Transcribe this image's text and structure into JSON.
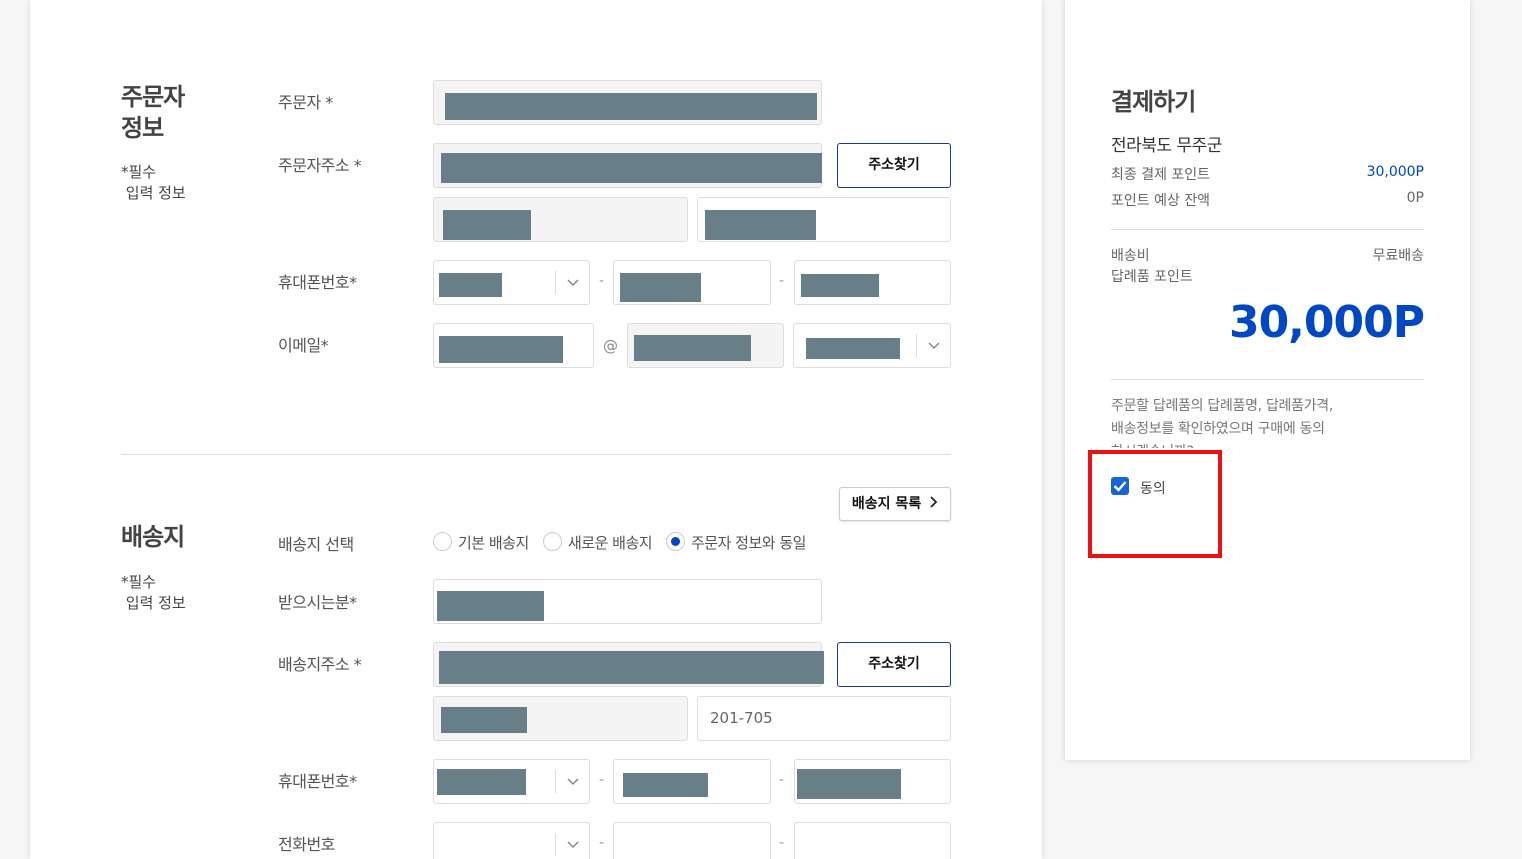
{
  "orderer": {
    "title": "주문자\n정보",
    "required_note": "*필수\n 입력 정보",
    "name_label": "주문자 *",
    "address_label": "주문자주소 *",
    "address_search_button": "주소찾기",
    "phone_label": "휴대폰번호*",
    "email_label": "이메일*",
    "email_at": "@",
    "phone_sep": "-"
  },
  "shipping": {
    "title": "배송지",
    "required_note": "*필수\n 입력 정보",
    "list_button": "배송지 목록",
    "select_label": "배송지 선택",
    "radio_options": [
      "기본 배송지",
      "새로운 배송지",
      "주문자 정보와 동일"
    ],
    "selected_option": "주문자 정보와 동일",
    "recipient_label": "받으시는분*",
    "address_label": "배송지주소 *",
    "address_search_button": "주소찾기",
    "address_detail_value": "201-705",
    "phone_label": "휴대폰번호*",
    "tel_label": "전화번호",
    "phone_sep": "-"
  },
  "payment": {
    "title": "결제하기",
    "region": "전라북도 무주군",
    "final_points_label": "최종 결제 포인트",
    "final_points_value": "30,000P",
    "expected_balance_label": "포인트 예상 잔액",
    "expected_balance_value": "0P",
    "shipping_fee_label": "배송비",
    "shipping_fee_value": "무료배송",
    "gift_points_label": "답례품 포인트",
    "total": "30,000P",
    "notice": "주문할 답례품의 답례품명, 답례품가격,\n배송정보를 확인하였으며 구매에 동의\n하시겠습니까?",
    "agree_label": "동의",
    "agree_checked": true
  },
  "colors": {
    "accent": "#0047c4",
    "redaction": "#697f88",
    "highlight": "#ee1111",
    "checkbox": "#1565d8"
  }
}
